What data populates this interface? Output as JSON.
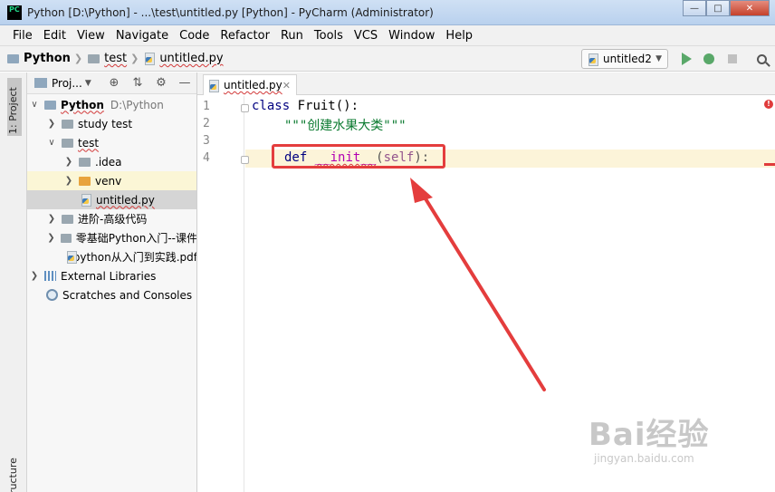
{
  "window": {
    "title": "Python [D:\\Python] - ...\\test\\untitled.py [Python] - PyCharm (Administrator)",
    "app_icon": "PC",
    "buttons": [
      "minimize-icon",
      "maximize-icon",
      "close-icon"
    ]
  },
  "menu": [
    "File",
    "Edit",
    "View",
    "Navigate",
    "Code",
    "Refactor",
    "Run",
    "Tools",
    "VCS",
    "Window",
    "Help"
  ],
  "breadcrumb": [
    "Python",
    "test",
    "untitled.py"
  ],
  "run_config": "untitled2",
  "left_strip": {
    "project_tab": "1: Project",
    "structure_tab": "ructure"
  },
  "project_panel": {
    "title": "Proj...",
    "tree": [
      {
        "label": "Python",
        "extra": "D:\\Python",
        "expanded": true
      },
      {
        "label": "study test"
      },
      {
        "label": "test",
        "expanded": true
      },
      {
        "label": ".idea"
      },
      {
        "label": "venv"
      },
      {
        "label": "untitled.py",
        "selected": true
      },
      {
        "label": "进阶-高级代码"
      },
      {
        "label": "零基础Python入门--课件"
      },
      {
        "label": "python从入门到实践.pdf"
      },
      {
        "label": "External Libraries"
      },
      {
        "label": "Scratches and Consoles"
      }
    ]
  },
  "editor": {
    "tab_label": "untitled.py",
    "line_numbers": [
      "1",
      "2",
      "3",
      "4"
    ],
    "code": {
      "line1_kw": "class",
      "line1_rest": " Fruit():",
      "line2": "\"\"\"创建水果大类\"\"\"",
      "line4_kw": "def",
      "line4_name": "__init__",
      "line4_paren_open": "(",
      "line4_self": "self",
      "line4_end": "):"
    },
    "error_indicator": "!"
  },
  "watermark": {
    "main": "Bai经验",
    "sub": "jingyan.baidu.com"
  },
  "colors": {
    "annotation": "#e43d3d",
    "current_line": "#fcf4d9",
    "keyword": "#000080"
  }
}
